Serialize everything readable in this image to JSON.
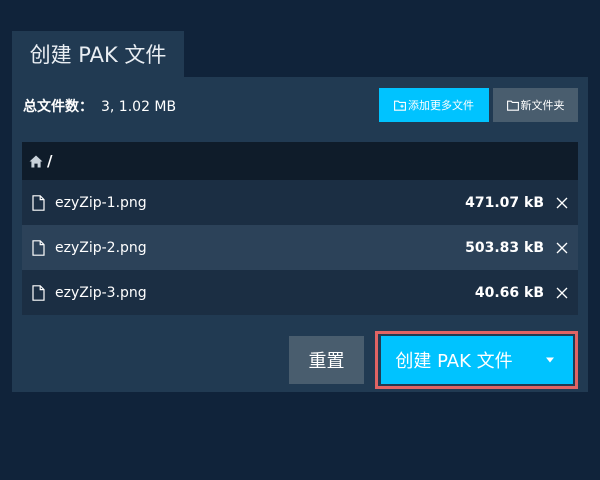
{
  "tab": {
    "title": "创建 PAK 文件"
  },
  "summary": {
    "label": "总文件数：",
    "value": "3, 1.02 MB"
  },
  "toolbar": {
    "add_more_label": "添加更多文件",
    "new_folder_label": "新文件夹"
  },
  "path": {
    "current": "/"
  },
  "files": [
    {
      "name": "ezyZip-1.png",
      "size": "471.07 kB"
    },
    {
      "name": "ezyZip-2.png",
      "size": "503.83 kB"
    },
    {
      "name": "ezyZip-3.png",
      "size": "40.66 kB"
    }
  ],
  "actions": {
    "reset_label": "重置",
    "create_label": "创建 PAK 文件"
  },
  "icons": {
    "home": "home-icon",
    "file": "file-icon",
    "remove": "close-icon",
    "folder_add": "folder-plus-icon",
    "folder": "folder-icon",
    "caret": "chevron-down-icon"
  },
  "colors": {
    "background": "#10233a",
    "panel": "#213a52",
    "accent": "#00c3ff",
    "secondary_button": "#495d6e",
    "highlight_border": "#e06464"
  }
}
